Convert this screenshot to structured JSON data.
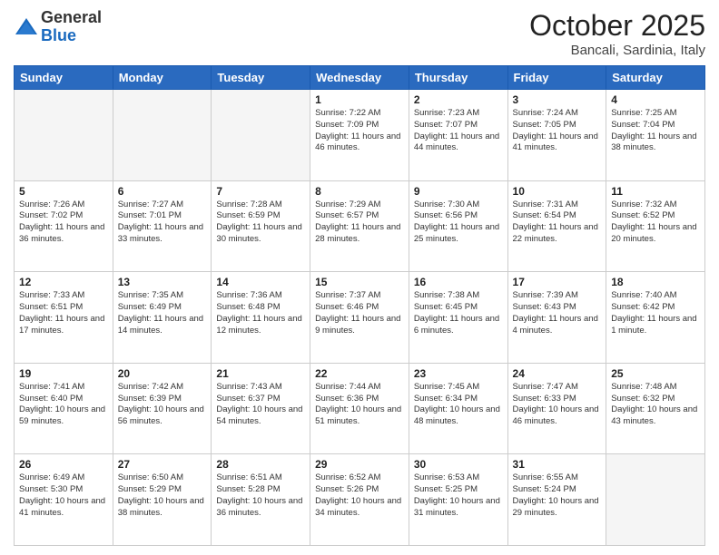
{
  "logo": {
    "general": "General",
    "blue": "Blue"
  },
  "title": "October 2025",
  "location": "Bancali, Sardinia, Italy",
  "days_header": [
    "Sunday",
    "Monday",
    "Tuesday",
    "Wednesday",
    "Thursday",
    "Friday",
    "Saturday"
  ],
  "weeks": [
    [
      {
        "day": "",
        "info": ""
      },
      {
        "day": "",
        "info": ""
      },
      {
        "day": "",
        "info": ""
      },
      {
        "day": "1",
        "info": "Sunrise: 7:22 AM\nSunset: 7:09 PM\nDaylight: 11 hours and 46 minutes."
      },
      {
        "day": "2",
        "info": "Sunrise: 7:23 AM\nSunset: 7:07 PM\nDaylight: 11 hours and 44 minutes."
      },
      {
        "day": "3",
        "info": "Sunrise: 7:24 AM\nSunset: 7:05 PM\nDaylight: 11 hours and 41 minutes."
      },
      {
        "day": "4",
        "info": "Sunrise: 7:25 AM\nSunset: 7:04 PM\nDaylight: 11 hours and 38 minutes."
      }
    ],
    [
      {
        "day": "5",
        "info": "Sunrise: 7:26 AM\nSunset: 7:02 PM\nDaylight: 11 hours and 36 minutes."
      },
      {
        "day": "6",
        "info": "Sunrise: 7:27 AM\nSunset: 7:01 PM\nDaylight: 11 hours and 33 minutes."
      },
      {
        "day": "7",
        "info": "Sunrise: 7:28 AM\nSunset: 6:59 PM\nDaylight: 11 hours and 30 minutes."
      },
      {
        "day": "8",
        "info": "Sunrise: 7:29 AM\nSunset: 6:57 PM\nDaylight: 11 hours and 28 minutes."
      },
      {
        "day": "9",
        "info": "Sunrise: 7:30 AM\nSunset: 6:56 PM\nDaylight: 11 hours and 25 minutes."
      },
      {
        "day": "10",
        "info": "Sunrise: 7:31 AM\nSunset: 6:54 PM\nDaylight: 11 hours and 22 minutes."
      },
      {
        "day": "11",
        "info": "Sunrise: 7:32 AM\nSunset: 6:52 PM\nDaylight: 11 hours and 20 minutes."
      }
    ],
    [
      {
        "day": "12",
        "info": "Sunrise: 7:33 AM\nSunset: 6:51 PM\nDaylight: 11 hours and 17 minutes."
      },
      {
        "day": "13",
        "info": "Sunrise: 7:35 AM\nSunset: 6:49 PM\nDaylight: 11 hours and 14 minutes."
      },
      {
        "day": "14",
        "info": "Sunrise: 7:36 AM\nSunset: 6:48 PM\nDaylight: 11 hours and 12 minutes."
      },
      {
        "day": "15",
        "info": "Sunrise: 7:37 AM\nSunset: 6:46 PM\nDaylight: 11 hours and 9 minutes."
      },
      {
        "day": "16",
        "info": "Sunrise: 7:38 AM\nSunset: 6:45 PM\nDaylight: 11 hours and 6 minutes."
      },
      {
        "day": "17",
        "info": "Sunrise: 7:39 AM\nSunset: 6:43 PM\nDaylight: 11 hours and 4 minutes."
      },
      {
        "day": "18",
        "info": "Sunrise: 7:40 AM\nSunset: 6:42 PM\nDaylight: 11 hours and 1 minute."
      }
    ],
    [
      {
        "day": "19",
        "info": "Sunrise: 7:41 AM\nSunset: 6:40 PM\nDaylight: 10 hours and 59 minutes."
      },
      {
        "day": "20",
        "info": "Sunrise: 7:42 AM\nSunset: 6:39 PM\nDaylight: 10 hours and 56 minutes."
      },
      {
        "day": "21",
        "info": "Sunrise: 7:43 AM\nSunset: 6:37 PM\nDaylight: 10 hours and 54 minutes."
      },
      {
        "day": "22",
        "info": "Sunrise: 7:44 AM\nSunset: 6:36 PM\nDaylight: 10 hours and 51 minutes."
      },
      {
        "day": "23",
        "info": "Sunrise: 7:45 AM\nSunset: 6:34 PM\nDaylight: 10 hours and 48 minutes."
      },
      {
        "day": "24",
        "info": "Sunrise: 7:47 AM\nSunset: 6:33 PM\nDaylight: 10 hours and 46 minutes."
      },
      {
        "day": "25",
        "info": "Sunrise: 7:48 AM\nSunset: 6:32 PM\nDaylight: 10 hours and 43 minutes."
      }
    ],
    [
      {
        "day": "26",
        "info": "Sunrise: 6:49 AM\nSunset: 5:30 PM\nDaylight: 10 hours and 41 minutes."
      },
      {
        "day": "27",
        "info": "Sunrise: 6:50 AM\nSunset: 5:29 PM\nDaylight: 10 hours and 38 minutes."
      },
      {
        "day": "28",
        "info": "Sunrise: 6:51 AM\nSunset: 5:28 PM\nDaylight: 10 hours and 36 minutes."
      },
      {
        "day": "29",
        "info": "Sunrise: 6:52 AM\nSunset: 5:26 PM\nDaylight: 10 hours and 34 minutes."
      },
      {
        "day": "30",
        "info": "Sunrise: 6:53 AM\nSunset: 5:25 PM\nDaylight: 10 hours and 31 minutes."
      },
      {
        "day": "31",
        "info": "Sunrise: 6:55 AM\nSunset: 5:24 PM\nDaylight: 10 hours and 29 minutes."
      },
      {
        "day": "",
        "info": ""
      }
    ]
  ]
}
